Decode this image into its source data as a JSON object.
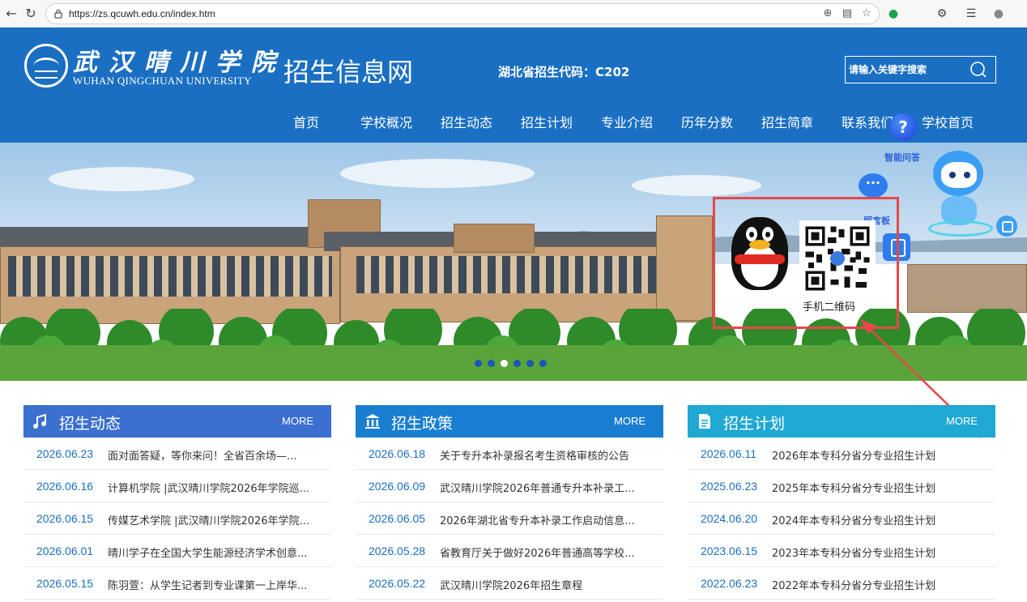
{
  "browser": {
    "url": "https://zs.qcuwh.edu.cn/index.htm"
  },
  "header": {
    "university_cn": "武汉晴川学院",
    "university_en": "WUHAN QINGCHUAN UNIVERSITY",
    "site_name": "招生信息网",
    "province_code_label": "湖北省招生代码：C202",
    "search_placeholder": "请输入关键字搜索"
  },
  "nav": {
    "items": [
      {
        "label": "首页"
      },
      {
        "label": "学校概况"
      },
      {
        "label": "招生动态"
      },
      {
        "label": "招生计划"
      },
      {
        "label": "专业介绍"
      },
      {
        "label": "历年分数"
      },
      {
        "label": "招生简章"
      },
      {
        "label": "联系我们"
      },
      {
        "label": "学校首页"
      }
    ]
  },
  "widgets": {
    "qa_label": "智能问答",
    "message_label": "留言板",
    "qr_caption": "手机二维码"
  },
  "banner": {
    "slide_count": 6,
    "active_slide": 3
  },
  "columns": [
    {
      "title": "招生动态",
      "more": "MORE",
      "color": "#3b6fd0",
      "items": [
        {
          "date": "2026.06.23",
          "title": "面对面答疑，等你来问！全省百余场—..."
        },
        {
          "date": "2026.06.16",
          "title": "计算机学院 |武汉晴川学院2026年学院巡..."
        },
        {
          "date": "2026.06.15",
          "title": "传媒艺术学院 |武汉晴川学院2026年学院..."
        },
        {
          "date": "2026.06.01",
          "title": "晴川学子在全国大学生能源经济学术创意..."
        },
        {
          "date": "2026.05.15",
          "title": "陈羽萱：从学生记者到专业课第一上岸华..."
        }
      ]
    },
    {
      "title": "招生政策",
      "more": "MORE",
      "color": "#1a7ed0",
      "items": [
        {
          "date": "2026.06.18",
          "title": "关于专升本补录报名考生资格审核的公告"
        },
        {
          "date": "2026.06.09",
          "title": "武汉晴川学院2026年普通专升本补录工..."
        },
        {
          "date": "2026.06.05",
          "title": "2026年湖北省专升本补录工作启动信息..."
        },
        {
          "date": "2026.05.28",
          "title": "省教育厅关于做好2026年普通高等学校..."
        },
        {
          "date": "2026.05.22",
          "title": "武汉晴川学院2026年招生章程"
        }
      ]
    },
    {
      "title": "招生计划",
      "more": "MORE",
      "color": "#1fa8d2",
      "items": [
        {
          "date": "2026.06.11",
          "title": "2026年本专科分省分专业招生计划"
        },
        {
          "date": "2025.06.23",
          "title": "2025年本专科分省分专业招生计划"
        },
        {
          "date": "2024.06.20",
          "title": "2024年本专科分省分专业招生计划"
        },
        {
          "date": "2023.06.15",
          "title": "2023年本专科分省分专业招生计划"
        },
        {
          "date": "2022.06.23",
          "title": "2022年本专科分省分专业招生计划"
        }
      ]
    }
  ],
  "colors": {
    "header_blue": "#1a6fc2",
    "highlight_red": "#e8474a",
    "date_blue": "#1a6fc2"
  }
}
